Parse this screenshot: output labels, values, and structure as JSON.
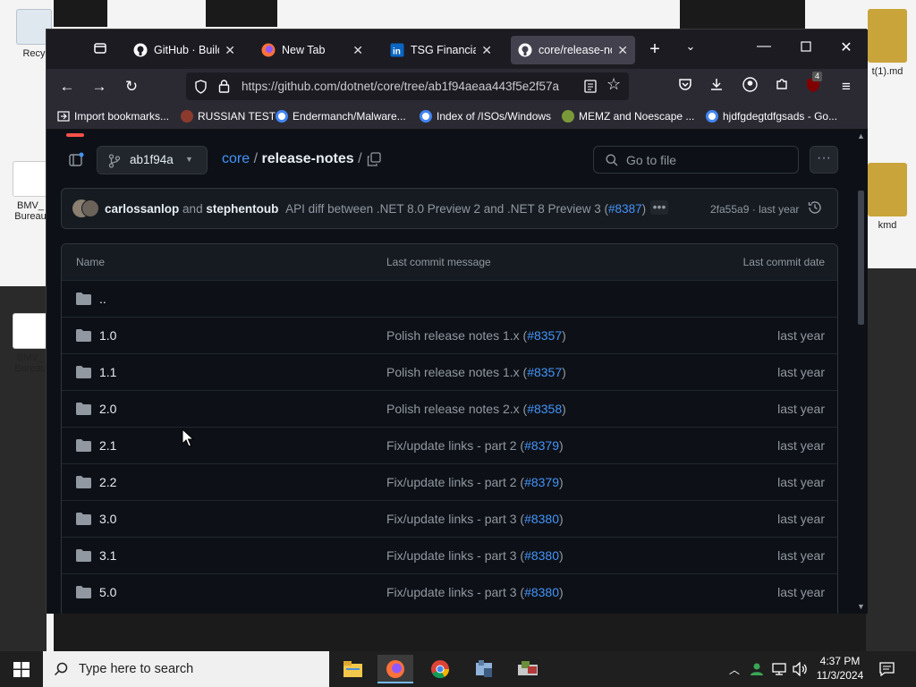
{
  "desktop": {
    "icons": [
      {
        "label": "Recy"
      },
      {
        "label": "BMV_ Bureau"
      },
      {
        "label": "BMV_ Bureau"
      },
      {
        "label": "t(1).md"
      },
      {
        "label": "kmd"
      }
    ]
  },
  "browser": {
    "tabs": [
      {
        "label": "GitHub · Build a",
        "icon": "github-icon"
      },
      {
        "label": "New Tab",
        "icon": "firefox-icon"
      },
      {
        "label": "TSG Financial, A",
        "icon": "linkedin-icon"
      },
      {
        "label": "core/release-no",
        "icon": "github-icon"
      }
    ],
    "url": "https://github.com/dotnet/core/tree/ab1f94aeaa443f5e2f57a",
    "extension_badge": "4",
    "bookmarks": [
      {
        "label": "Import bookmarks..."
      },
      {
        "label": "RUSSIAN TEST"
      },
      {
        "label": "Endermanch/Malware..."
      },
      {
        "label": "Index of /ISOs/Windows"
      },
      {
        "label": "MEMZ and Noescape ..."
      },
      {
        "label": "hjdfgdegtdfgsads - Go..."
      }
    ]
  },
  "repo": {
    "branch": "ab1f94a",
    "path_root": "core",
    "path_sep": "/",
    "path_folder": "release-notes",
    "path_trail": "/",
    "search_placeholder": "Go to file",
    "commit": {
      "author1": "carlossanlop",
      "and": "and",
      "author2": "stephentoub",
      "message": "API diff between .NET 8.0 Preview 2 and .NET 8 Preview 3 (",
      "pr": "#8387",
      "close": ")",
      "sha": "2fa55a9",
      "dot": "·",
      "age": "last year"
    },
    "table": {
      "headers": {
        "name": "Name",
        "message": "Last commit message",
        "date": "Last commit date"
      },
      "parent": "..",
      "rows": [
        {
          "name": "1.0",
          "message": "Polish release notes 1.x (",
          "pr": "#8357",
          "close": ")",
          "date": "last year"
        },
        {
          "name": "1.1",
          "message": "Polish release notes 1.x (",
          "pr": "#8357",
          "close": ")",
          "date": "last year"
        },
        {
          "name": "2.0",
          "message": "Polish release notes 2.x (",
          "pr": "#8358",
          "close": ")",
          "date": "last year"
        },
        {
          "name": "2.1",
          "message": "Fix/update links - part 2 (",
          "pr": "#8379",
          "close": ")",
          "date": "last year"
        },
        {
          "name": "2.2",
          "message": "Fix/update links - part 2 (",
          "pr": "#8379",
          "close": ")",
          "date": "last year"
        },
        {
          "name": "3.0",
          "message": "Fix/update links - part 3 (",
          "pr": "#8380",
          "close": ")",
          "date": "last year"
        },
        {
          "name": "3.1",
          "message": "Fix/update links - part 3 (",
          "pr": "#8380",
          "close": ")",
          "date": "last year"
        },
        {
          "name": "5.0",
          "message": "Fix/update links - part 3 (",
          "pr": "#8380",
          "close": ")",
          "date": "last year"
        }
      ]
    }
  },
  "taskbar": {
    "search_placeholder": "Type here to search",
    "time": "4:37 PM",
    "date": "11/3/2024"
  },
  "colors": {
    "accent": "#4493f8",
    "page_bg": "#0d1117",
    "border": "#30363d",
    "muted": "#9198a1"
  }
}
